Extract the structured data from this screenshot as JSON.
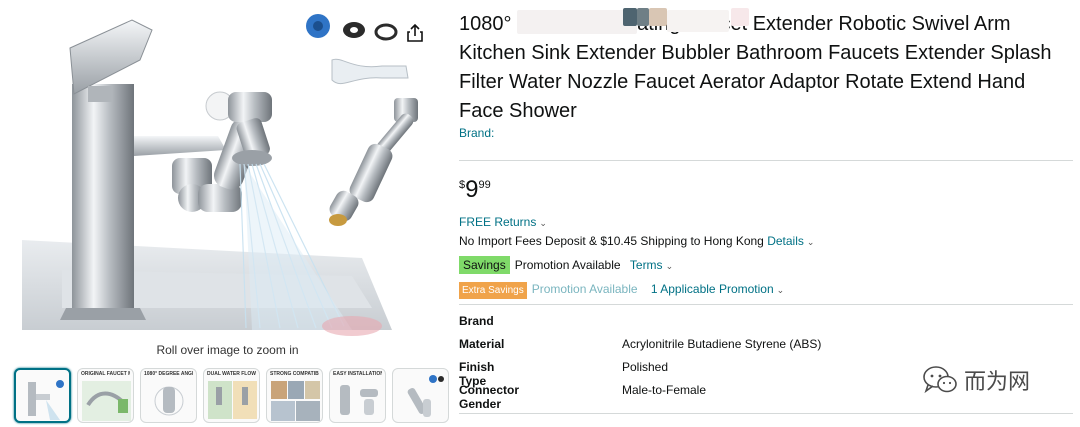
{
  "gallery": {
    "zoom_hint": "Roll over image to zoom in",
    "thumbnails": [
      {
        "caption": ""
      },
      {
        "caption": "ORIGINAL FAUCET MODE"
      },
      {
        "caption": "1080° DEGREE ANGLE"
      },
      {
        "caption": "DUAL WATER FLOW MODE"
      },
      {
        "caption": "STRONG COMPATIBILITY"
      },
      {
        "caption": "EASY INSTALLATION"
      },
      {
        "caption": ""
      }
    ]
  },
  "product": {
    "title": "1080° Universal Rotating Faucet Extender Robotic Swivel Arm Kitchen Sink Extender Bubbler Bathroom Faucets Extender Splash Filter Water Nozzle Faucet Aerator Adaptor Rotate Extend Hand Face Shower",
    "brand_label": "Brand:",
    "price": {
      "currency": "$",
      "whole": "9",
      "fraction": "99"
    },
    "free_returns": "FREE Returns",
    "shipping_text": "No Import Fees Deposit & $10.45 Shipping to Hong Kong",
    "details_link": "Details",
    "savings_badge": "Savings",
    "promotion_available": "Promotion Available",
    "terms_link": "Terms",
    "extra_savings_badge": "Extra Savings",
    "extra_promotion_text": "Promotion Available",
    "applicable_promotion": "1 Applicable Promotion"
  },
  "specs": [
    {
      "key": "Brand",
      "value": ""
    },
    {
      "key": "Material",
      "value": "Acrylonitrile Butadiene Styrene (ABS)"
    },
    {
      "key": "Finish Type",
      "value": "Polished"
    },
    {
      "key": "Connector Gender",
      "value": "Male-to-Female"
    }
  ],
  "watermark": {
    "text": "而为网"
  },
  "colors": {
    "link": "#007185",
    "savings_badge": "#7fda69",
    "extra_savings_badge": "#f0a34a",
    "divider": "#d5d9d9"
  }
}
